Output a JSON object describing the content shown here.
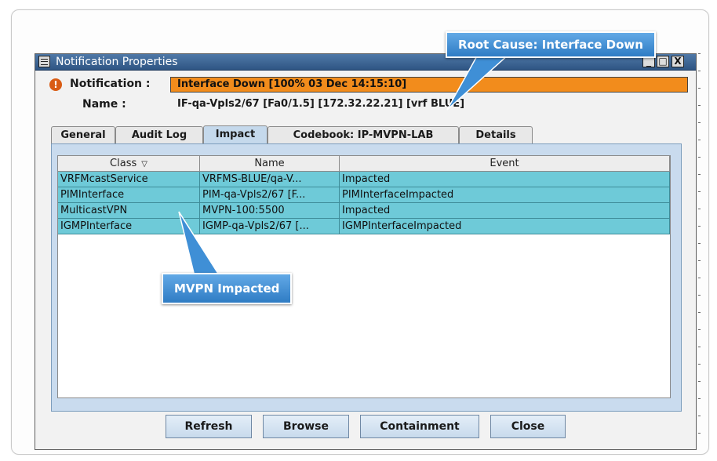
{
  "window": {
    "title": "Notification Properties",
    "controls": {
      "minimize": "_",
      "maximize": "□",
      "close": "X"
    }
  },
  "callouts": {
    "root_cause": "Root Cause: Interface Down",
    "mvpn": "MVPN Impacted"
  },
  "notification": {
    "label": "Notification :",
    "value": "Interface Down  [100% 03 Dec 14:15:10]",
    "icon": "warning-icon"
  },
  "name": {
    "label": "Name :",
    "value": "IF-qa-Vpls2/67 [Fa0/1.5] [172.32.22.21] [vrf BLUE]"
  },
  "tabs": [
    {
      "label": "General"
    },
    {
      "label": "Audit Log"
    },
    {
      "label": "Impact"
    },
    {
      "label": "Codebook: IP-MVPN-LAB"
    },
    {
      "label": "Details"
    }
  ],
  "active_tab": "Impact",
  "table": {
    "columns": [
      "Class",
      "Name",
      "Event"
    ],
    "sort_indicator": "▽",
    "rows": [
      [
        "VRFMcastService",
        "VRFMS-BLUE/qa-V...",
        "Impacted"
      ],
      [
        "PIMInterface",
        "PIM-qa-Vpls2/67 [F...",
        "PIMInterfaceImpacted"
      ],
      [
        "MulticastVPN",
        "MVPN-100:5500",
        "Impacted"
      ],
      [
        "IGMPInterface",
        "IGMP-qa-Vpls2/67 [...",
        "IGMPInterfaceImpacted"
      ]
    ]
  },
  "buttons": {
    "refresh": "Refresh",
    "browse": "Browse",
    "containment": "Containment",
    "close": "Close"
  },
  "colors": {
    "title_bar": "#3a6595",
    "notification_bg": "#f28c1c",
    "row_highlight": "#6ecad8",
    "callout": "#3f8fd6"
  }
}
